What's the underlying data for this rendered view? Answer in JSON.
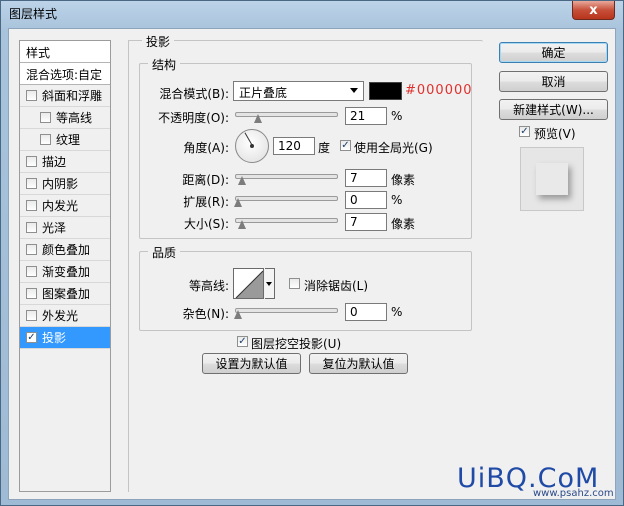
{
  "window": {
    "title": "图层样式",
    "close_label": "x"
  },
  "sidebar": {
    "header": "样式",
    "blend_options": "混合选项:自定",
    "items": [
      {
        "label": "斜面和浮雕",
        "checked": false,
        "indent": false
      },
      {
        "label": "等高线",
        "checked": false,
        "indent": true
      },
      {
        "label": "纹理",
        "checked": false,
        "indent": true
      },
      {
        "label": "描边",
        "checked": false,
        "indent": false
      },
      {
        "label": "内阴影",
        "checked": false,
        "indent": false
      },
      {
        "label": "内发光",
        "checked": false,
        "indent": false
      },
      {
        "label": "光泽",
        "checked": false,
        "indent": false
      },
      {
        "label": "颜色叠加",
        "checked": false,
        "indent": false
      },
      {
        "label": "渐变叠加",
        "checked": false,
        "indent": false
      },
      {
        "label": "图案叠加",
        "checked": false,
        "indent": false
      },
      {
        "label": "外发光",
        "checked": false,
        "indent": false
      },
      {
        "label": "投影",
        "checked": true,
        "indent": false,
        "active": true
      }
    ]
  },
  "drop_shadow": {
    "title": "投影",
    "structure": {
      "title": "结构",
      "blend_mode_label": "混合模式(B):",
      "blend_mode_value": "正片叠底",
      "color_hex": "#000000",
      "opacity_label": "不透明度(O):",
      "opacity_value": "21",
      "opacity_unit": "%",
      "angle_label": "角度(A):",
      "angle_value": "120",
      "angle_unit": "度",
      "global_light_label": "使用全局光(G)",
      "global_light_checked": true,
      "distance_label": "距离(D):",
      "distance_value": "7",
      "distance_unit": "像素",
      "spread_label": "扩展(R):",
      "spread_value": "0",
      "spread_unit": "%",
      "size_label": "大小(S):",
      "size_value": "7",
      "size_unit": "像素"
    },
    "quality": {
      "title": "品质",
      "contour_label": "等高线:",
      "antialias_label": "消除锯齿(L)",
      "antialias_checked": false,
      "noise_label": "杂色(N):",
      "noise_value": "0",
      "noise_unit": "%"
    },
    "knockout_label": "图层挖空投影(U)",
    "knockout_checked": true,
    "set_default_label": "设置为默认值",
    "reset_default_label": "复位为默认值"
  },
  "buttons": {
    "ok": "确定",
    "cancel": "取消",
    "new_style": "新建样式(W)...",
    "preview_label": "预览(V)",
    "preview_checked": true
  },
  "watermark": {
    "text": "UiBQ.CoM",
    "sub": "www.psahz.com"
  },
  "colors": {
    "accent": "#3399ff",
    "hex_text": "#e0302c",
    "shadow_color": "#000000"
  }
}
